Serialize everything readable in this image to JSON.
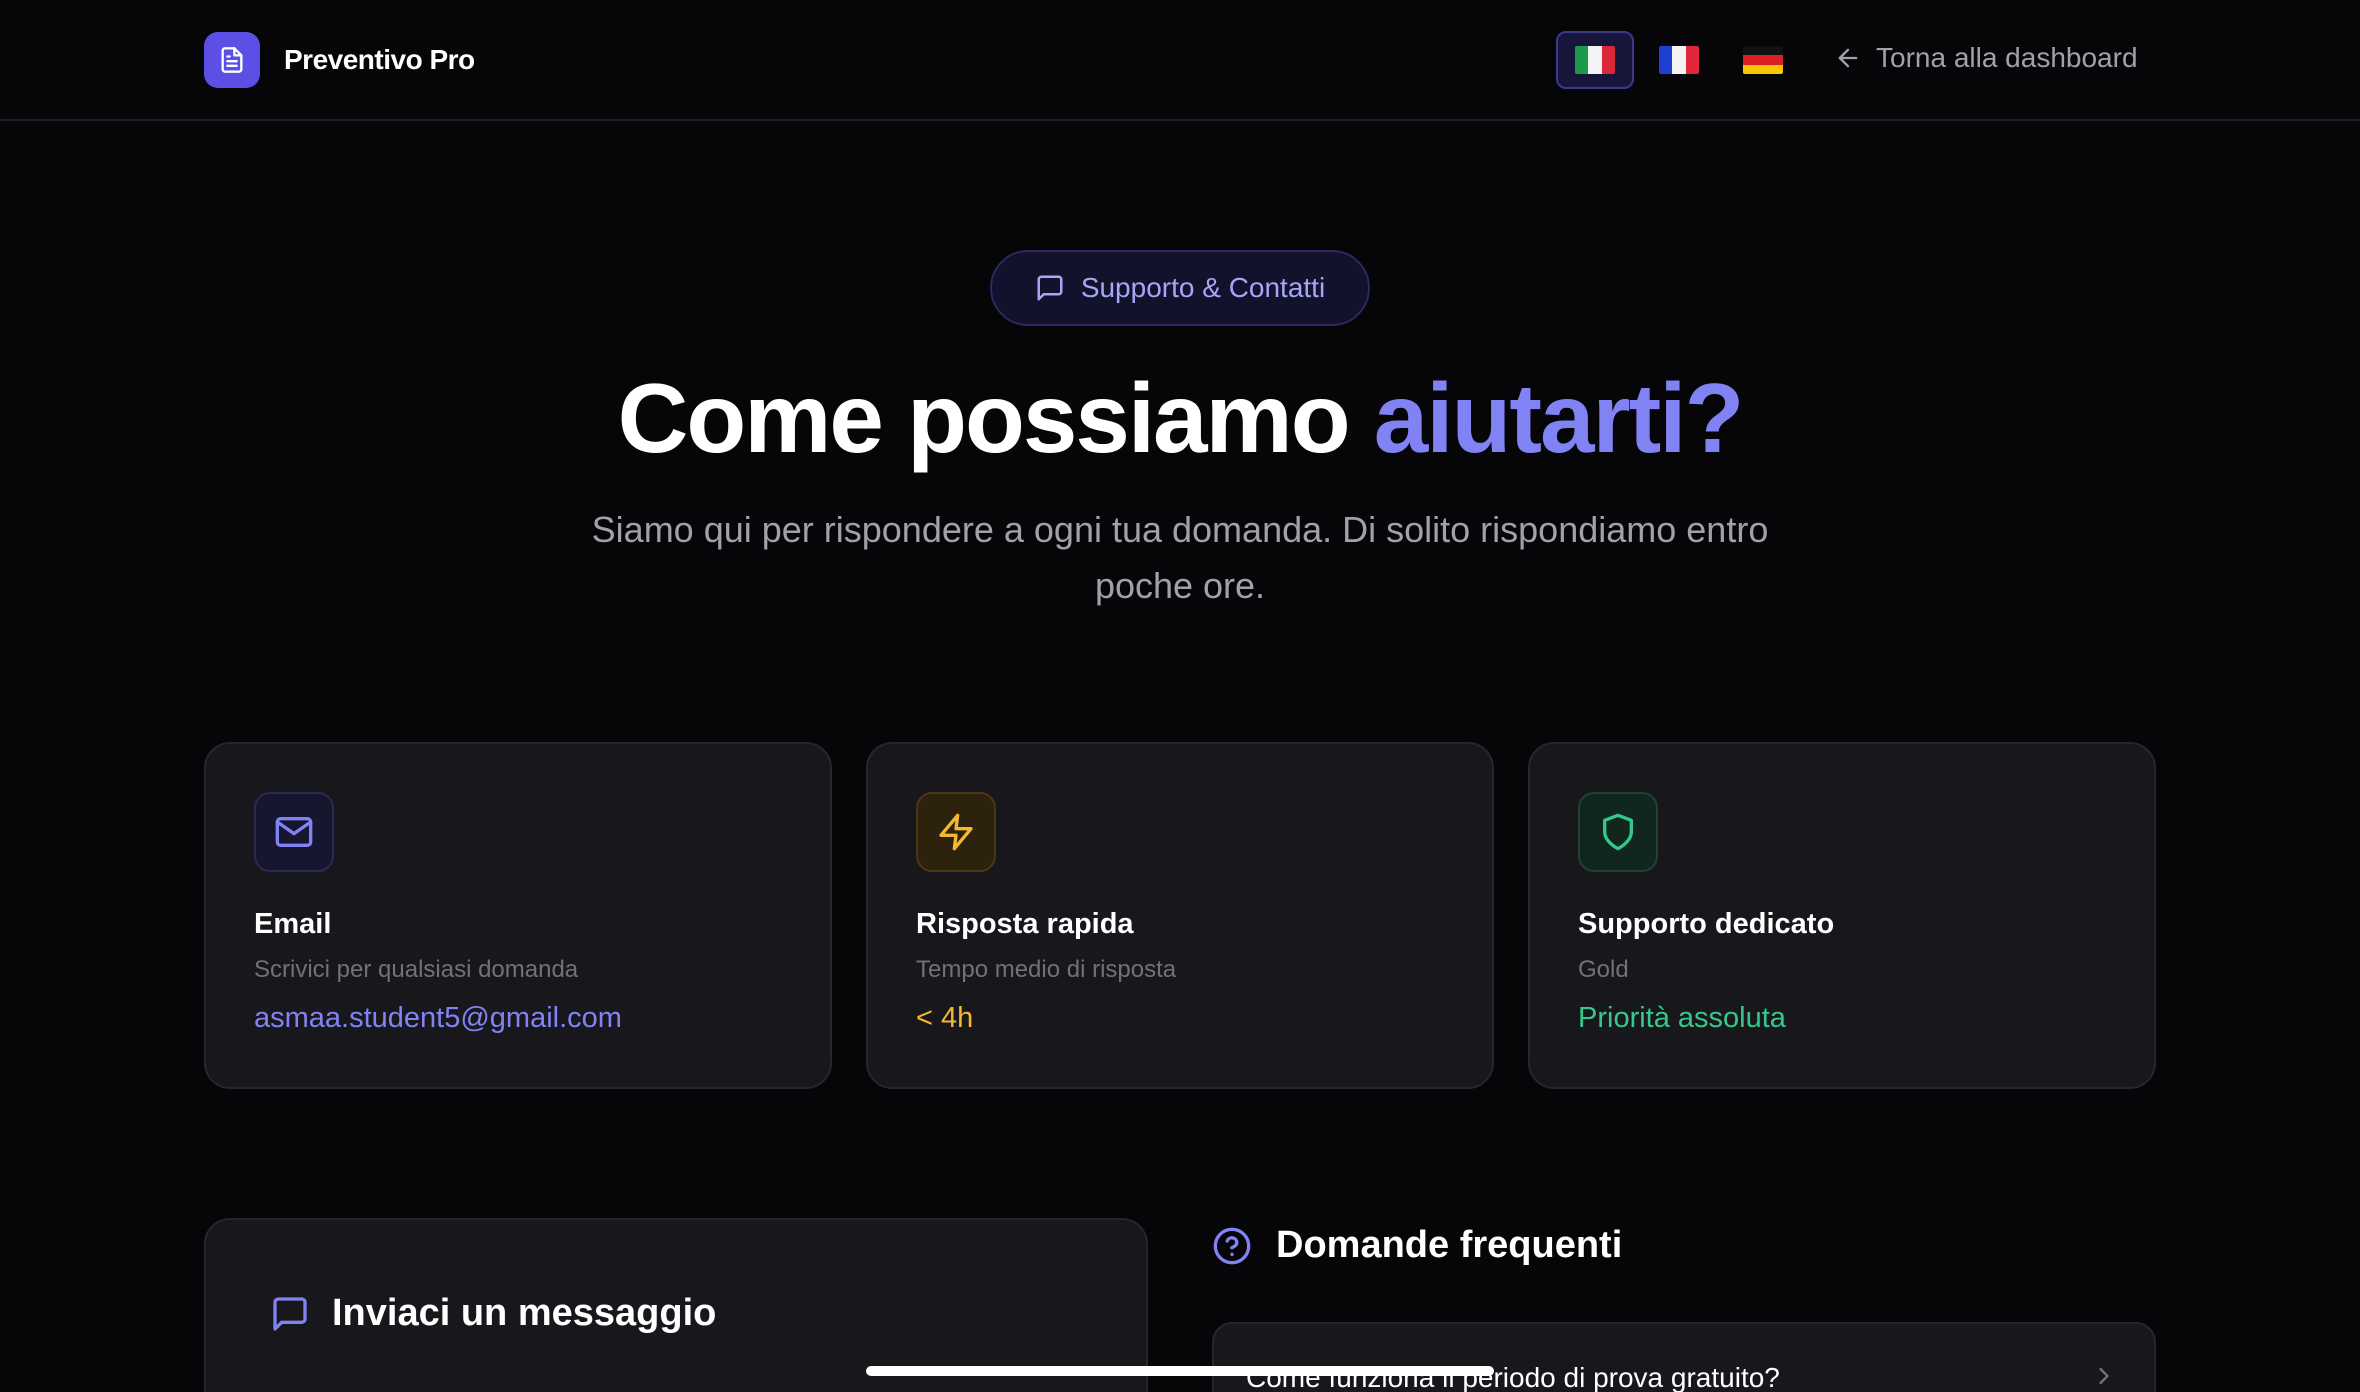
{
  "header": {
    "brand_name": "Preventivo Pro",
    "languages": [
      {
        "code": "it",
        "active": true
      },
      {
        "code": "fr",
        "active": false
      },
      {
        "code": "de",
        "active": false
      }
    ],
    "back_label": "Torna alla dashboard"
  },
  "hero": {
    "pill_label": "Supporto & Contatti",
    "title_main": "Come possiamo",
    "title_accent": "aiutarti?",
    "subtitle": "Siamo qui per rispondere a ogni tua domanda. Di solito rispondiamo entro poche ore."
  },
  "cards": [
    {
      "title": "Email",
      "description": "Scrivici per qualsiasi domanda",
      "value": "asmaa.student5@gmail.com",
      "icon": "mail-icon",
      "accent": "#8183f4"
    },
    {
      "title": "Risposta rapida",
      "description": "Tempo medio di risposta",
      "value": "< 4h",
      "icon": "lightning-icon",
      "accent": "#f5b731"
    },
    {
      "title": "Supporto dedicato",
      "description": "Gold",
      "value": "Priorità assoluta",
      "icon": "shield-icon",
      "accent": "#34c98a"
    }
  ],
  "contact_form": {
    "title": "Inviaci un messaggio"
  },
  "faq": {
    "title": "Domande frequenti",
    "items": [
      {
        "question": "Come funziona il periodo di prova gratuito?"
      }
    ]
  },
  "colors": {
    "background": "#060608",
    "card": "#18181c",
    "brand": "#5b4fe6",
    "accent": "#8183f4"
  }
}
